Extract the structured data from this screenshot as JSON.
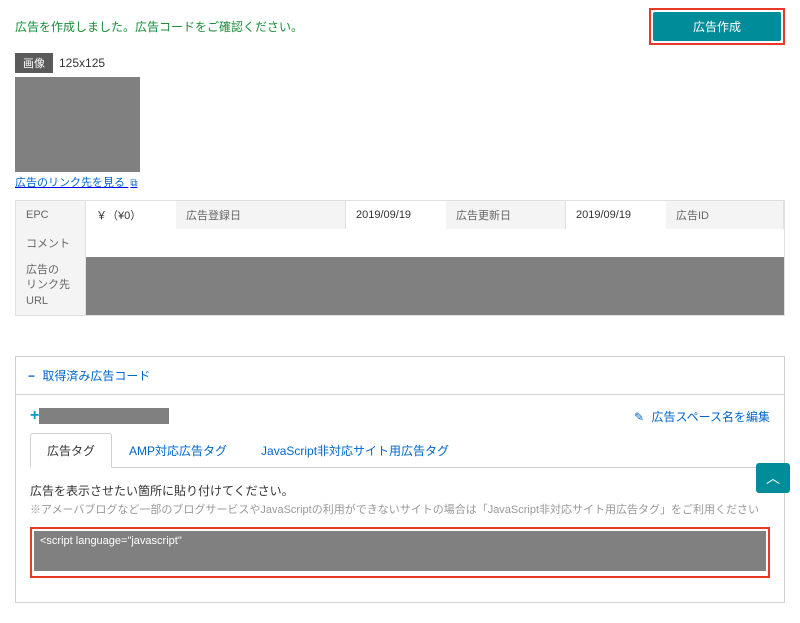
{
  "topbar": {
    "success_message": "広告を作成しました。広告コードをご確認ください。",
    "create_button": "広告作成"
  },
  "ad_preview": {
    "badge": "画像",
    "dimensions": "125x125",
    "link_preview_text": "広告のリンク先を見る"
  },
  "info": {
    "labels": {
      "epc": "EPC",
      "reg_date": "広告登録日",
      "upd_date": "広告更新日",
      "ad_id": "広告ID",
      "comment": "コメント",
      "link_url": "広告の\nリンク先URL"
    },
    "values": {
      "epc": "￥（¥0）",
      "reg_date": "2019/09/19",
      "upd_date": "2019/09/19"
    }
  },
  "code_section": {
    "header": "取得済み広告コード",
    "edit_space": "広告スペース名を編集",
    "tabs": {
      "tab1": "広告タグ",
      "tab2": "AMP対応広告タグ",
      "tab3": "JavaScript非対応サイト用広告タグ"
    },
    "instruction": "広告を表示させたい箇所に貼り付けてください。",
    "note": "※アメーバブログなど一部のブログサービスやJavaScriptの利用ができないサイトの場合は「JavaScript非対応サイト用広告タグ」をご利用ください",
    "code_value": "<script language=\"javascript\""
  }
}
